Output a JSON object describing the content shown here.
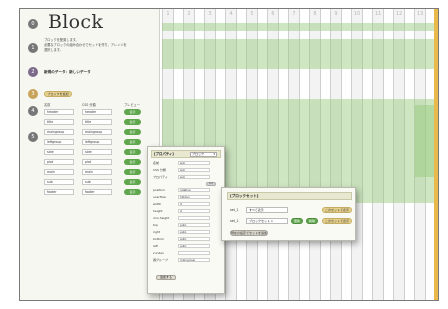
{
  "app": {
    "title": "Block",
    "description": [
      "ブロックを配置します。",
      "必要なブロックの組み合わせでセットを作り、アレンジを",
      "選択します。"
    ],
    "current_info": "新規のデータ：新しいデータ",
    "add_block_label": "ブロックを追加"
  },
  "steps": [
    "0",
    "1",
    "2",
    "3",
    "4",
    "5"
  ],
  "table": {
    "headers": [
      "名前",
      "CSS 分類",
      "プレビュー"
    ],
    "rows": [
      {
        "name": "header",
        "css": "header",
        "button": "表示"
      },
      {
        "name": "title",
        "css": "title",
        "button": "表示"
      },
      {
        "name": "maingroup",
        "css": "maingroup",
        "button": "表示"
      },
      {
        "name": "leftgroup",
        "css": "leftgroup",
        "button": "表示"
      },
      {
        "name": "side",
        "css": "side",
        "button": "表示"
      },
      {
        "name": "plot",
        "css": "plot",
        "button": "表示"
      },
      {
        "name": "main",
        "css": "main",
        "button": "表示"
      },
      {
        "name": "sub",
        "css": "sub",
        "button": "表示"
      },
      {
        "name": "footer",
        "css": "footer",
        "button": "表示"
      }
    ]
  },
  "grid": {
    "columns": [
      "1",
      "2",
      "3",
      "4",
      "5",
      "6",
      "7",
      "8",
      "9",
      "10",
      "11",
      "12",
      "13"
    ]
  },
  "property_panel": {
    "title": "[プロパティ]",
    "type_value": "ブロック",
    "rows": [
      {
        "label": "名前",
        "value": "sub"
      },
      {
        "label": "CSS 分類",
        "value": "sub"
      },
      {
        "label": "プロパティ",
        "value": "sub"
      },
      {
        "label": "position",
        "value": "relative"
      },
      {
        "label": "overflow",
        "value": "hidden"
      },
      {
        "label": "width",
        "value": "4"
      },
      {
        "label": "height",
        "value": "4"
      },
      {
        "label": "min-height",
        "value": ""
      },
      {
        "label": "top",
        "value": "auto"
      },
      {
        "label": "right",
        "value": "auto"
      },
      {
        "label": "bottom",
        "value": "auto"
      },
      {
        "label": "left",
        "value": "auto"
      },
      {
        "label": "z-index",
        "value": ""
      },
      {
        "label": "親グループ",
        "value": "maingroup"
      }
    ],
    "small_button": "(+)",
    "apply_button": "追加する"
  },
  "block_set": {
    "title": "[ブロックセット]",
    "set1_label": "set_1",
    "set1_value": "すべて表示",
    "set1_button": "このセットで表示",
    "set2_label": "set_1",
    "set2_value": "ブロックセット 1",
    "set2_btn_a": "更新",
    "set2_btn_b": "削除",
    "set2_button": "このセットで表示",
    "add_button": "現在の設定でセットを追加"
  },
  "colors": {
    "accent_green": "#5fa64d",
    "accent_gold": "#e6d08c",
    "band_green": "#92c878",
    "right_bar": "#e9b94b"
  }
}
